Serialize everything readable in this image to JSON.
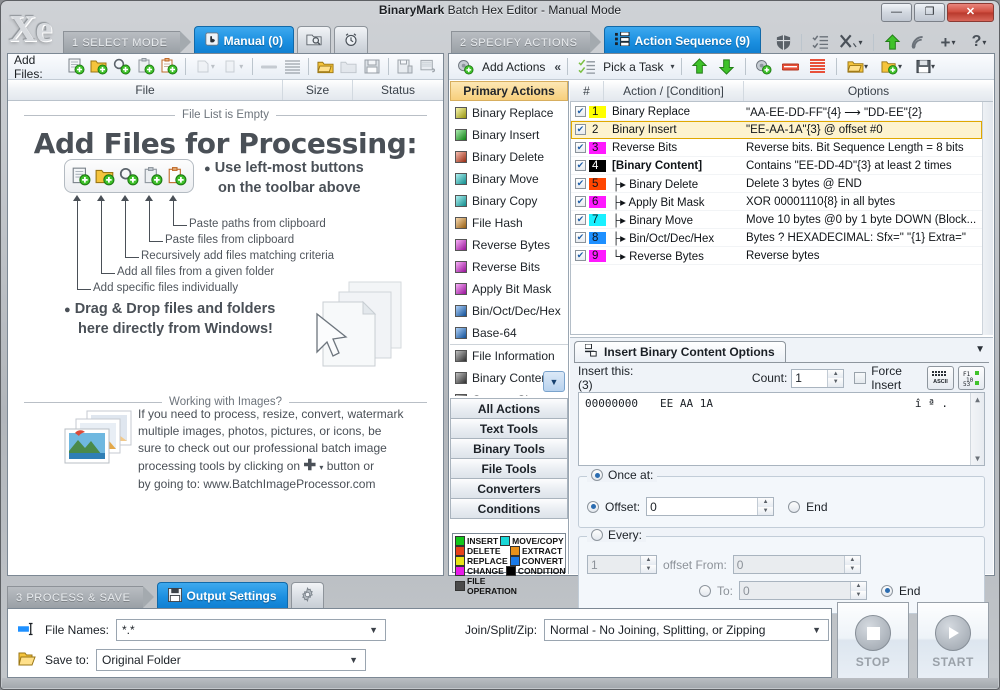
{
  "window": {
    "title_brand": "BinaryMark",
    "title_rest": "Batch Hex Editor - Manual Mode",
    "logo": "Xe",
    "minimize": "—",
    "maximize": "❐",
    "close": "✕"
  },
  "steps": {
    "step1": "1 SELECT MODE",
    "step2": "2 SPECIFY ACTIONS",
    "step3": "3 PROCESS & SAVE"
  },
  "mode_tabs": {
    "manual": "Manual (0)",
    "watch_icon": "folder-watch-icon",
    "schedule_icon": "alarm-clock-icon"
  },
  "actions_tab": {
    "label": "Action Sequence (9)"
  },
  "output_tab": {
    "label": "Output Settings",
    "gear_icon": "gear-icon"
  },
  "topright_icons": [
    "shield-icon",
    "checklist-icon",
    "tools-icon",
    "upload-icon",
    "rss-icon",
    "plus-icon",
    "help-icon"
  ],
  "files_toolbar": {
    "label": "Add Files:",
    "buttons": [
      "add-files-icon",
      "add-folder-icon",
      "add-recursive-icon",
      "paste-files-icon",
      "paste-paths-icon",
      "remove-dropdown-icon",
      "copy-dropdown-icon",
      "remove-icon",
      "clear-list-icon",
      "open-list-icon",
      "import-list-icon",
      "save-list-icon",
      "save-as-icon",
      "export-icon"
    ]
  },
  "file_columns": [
    "File",
    "Size",
    "Status"
  ],
  "empty_list": {
    "divider_top": "File List is Empty",
    "heading": "Add Files for Processing:",
    "bullet1_line1": "Use left-most buttons",
    "bullet1_line2": "on the toolbar above",
    "callouts": [
      "Paste paths from clipboard",
      "Paste files from clipboard",
      "Recursively add files matching criteria",
      "Add all files from a given folder",
      "Add specific files individually"
    ],
    "bullet2_line1": "Drag & Drop files and folders",
    "bullet2_line2": "here directly from Windows!",
    "divider_bottom": "Working with Images?",
    "images_text_1": "If you need to process, resize, convert, watermark",
    "images_text_2": "multiple images, photos, pictures, or icons, be",
    "images_text_3": "sure to check out our professional batch image",
    "images_text_4a": "processing tools by clicking on",
    "images_text_4b": "button or",
    "images_text_5": "by going to: www.BatchImageProcessor.com"
  },
  "actions_toolbar": {
    "add_actions": "Add Actions",
    "collapse": "«",
    "pick_task": "Pick a Task",
    "buttons": [
      "move-up-icon",
      "move-down-icon",
      "add-action-icon",
      "remove-action-icon",
      "clear-actions-icon",
      "open-sequence-icon",
      "import-sequence-icon",
      "save-sequence-icon"
    ]
  },
  "actions_panel": {
    "header": "Primary Actions",
    "items": [
      {
        "label": "Binary Replace",
        "color": "#e8e317"
      },
      {
        "label": "Binary Insert",
        "color": "#12c61a"
      },
      {
        "label": "Binary Delete",
        "color": "#e8411a"
      },
      {
        "label": "Binary Move",
        "color": "#1ad7d7"
      },
      {
        "label": "Binary Copy",
        "color": "#1ad7d7"
      },
      {
        "label": "File Hash",
        "color": "#e8911a"
      },
      {
        "label": "Reverse Bytes",
        "color": "#e81ae8"
      },
      {
        "label": "Reverse Bits",
        "color": "#e81ae8"
      },
      {
        "label": "Apply Bit Mask",
        "color": "#e81ae8"
      },
      {
        "label": "Bin/Oct/Dec/Hex",
        "color": "#1a7ae8"
      },
      {
        "label": "Base-64",
        "color": "#1a7ae8"
      },
      {
        "label": "File Information",
        "color": "#4a4a4a"
      },
      {
        "label": "Binary Content",
        "color": "#4a4a4a"
      },
      {
        "label": "Content Size",
        "color": "#4a4a4a"
      }
    ],
    "categories": [
      "All Actions",
      "Text Tools",
      "Binary Tools",
      "File Tools",
      "Converters",
      "Conditions"
    ],
    "legend": [
      {
        "label": "INSERT",
        "color": "#12c61a"
      },
      {
        "label": "MOVE/COPY",
        "color": "#1ad7d7"
      },
      {
        "label": "DELETE",
        "color": "#e8411a"
      },
      {
        "label": "EXTRACT",
        "color": "#e8911a"
      },
      {
        "label": "REPLACE",
        "color": "#e8e317"
      },
      {
        "label": "CONVERT",
        "color": "#1a7ae8"
      },
      {
        "label": "CHANGE",
        "color": "#e81ae8"
      },
      {
        "label": "CONDITION",
        "color": "#000000"
      },
      {
        "label": "FILE OPERATION",
        "color": "#4a4a4a"
      }
    ]
  },
  "sequence": {
    "columns": {
      "num": "#",
      "action": "Action / [Condition]",
      "options": "Options"
    },
    "rows": [
      {
        "n": "1",
        "color": "#ffff00",
        "name": "Binary Replace",
        "indent": "",
        "bold": false,
        "options": "\"AA-EE-DD-FF\"{4}  ⟶  \"DD-EE\"{2}",
        "checked": true,
        "selected": false
      },
      {
        "n": "2",
        "color": "#fdf3cf",
        "name": "Binary Insert",
        "indent": "",
        "bold": false,
        "options": "\"EE-AA-1A\"{3} @ offset #0",
        "checked": true,
        "selected": true
      },
      {
        "n": "3",
        "color": "#ff19ff",
        "name": "Reverse Bits",
        "indent": "",
        "bold": false,
        "options": "Reverse bits. Bit Sequence Length = 8 bits",
        "checked": true,
        "selected": false
      },
      {
        "n": "4",
        "color": "#000000",
        "name": "[Binary Content]",
        "indent": "",
        "bold": true,
        "options": "Contains \"EE-DD-4D\"{3} at least 2 times",
        "checked": true,
        "selected": false
      },
      {
        "n": "5",
        "color": "#ff4500",
        "name": "Binary Delete",
        "indent": "├▸",
        "bold": false,
        "options": "Delete 3 bytes @ END",
        "checked": true,
        "selected": false
      },
      {
        "n": "6",
        "color": "#ff19ff",
        "name": "Apply Bit Mask",
        "indent": "├▸",
        "bold": false,
        "options": "XOR 00001110{8} in all bytes",
        "checked": true,
        "selected": false
      },
      {
        "n": "7",
        "color": "#19f0ff",
        "name": "Binary Move",
        "indent": "├▸",
        "bold": false,
        "options": "Move 10 bytes @0 by 1 byte DOWN (Block...",
        "checked": true,
        "selected": false
      },
      {
        "n": "8",
        "color": "#1e90ff",
        "name": "Bin/Oct/Dec/Hex",
        "indent": "├▸",
        "bold": false,
        "options": "Bytes ? HEXADECIMAL: Sfx=\" \"{1} Extra=\"",
        "checked": true,
        "selected": false
      },
      {
        "n": "9",
        "color": "#ff19ff",
        "name": "Reverse Bytes",
        "indent": "└▸",
        "bold": false,
        "options": "Reverse bytes",
        "checked": true,
        "selected": false
      }
    ]
  },
  "options_panel": {
    "tab_title": "Insert Binary Content Options",
    "collapse_icon": "chevron-down-icon",
    "insert_label": "Insert this: (3)",
    "count_label": "Count:",
    "count_value": "1",
    "force_insert": "Force Insert",
    "ascii_button": "ascii-view-icon",
    "numeric_button": "numeric-view-icon",
    "hex_offset": "00000000",
    "hex_bytes": "EE AA 1A",
    "hex_ascii": "î ª .",
    "once_at": "Once at:",
    "offset_label": "Offset:",
    "offset_value": "0",
    "end_label_1": "End",
    "every_label": "Every:",
    "every_value": "1",
    "offset_from_label": "offset From:",
    "from_value": "0",
    "to_label": "To:",
    "to_value": "0",
    "end_label_2": "End"
  },
  "output": {
    "file_names_label": "File Names:",
    "file_names_value": "*.*",
    "save_to_label": "Save to:",
    "save_to_value": "Original Folder",
    "join_label": "Join/Split/Zip:",
    "join_value": "Normal - No Joining, Splitting, or Zipping",
    "stop": "STOP",
    "start": "START"
  }
}
